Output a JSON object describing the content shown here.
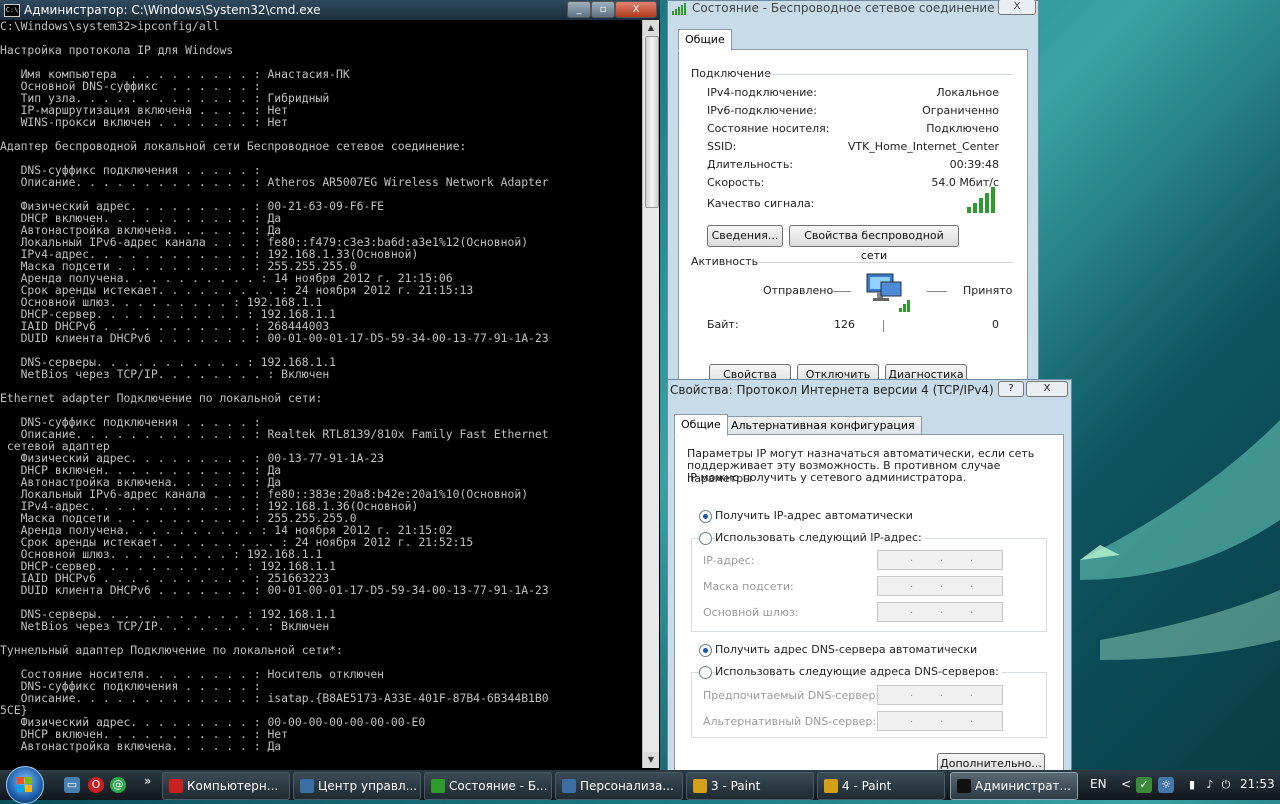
{
  "cmd": {
    "title": "Администратор: C:\\Windows\\System32\\cmd.exe",
    "minimize": "_",
    "maximize": "▫",
    "close": "X",
    "lines": [
      "C:\\Windows\\system32>ipconfig/all",
      "",
      "Настройка протокола IP для Windows",
      "",
      "   Имя компьютера  . . . . . . . . . : Анастасия-ПК",
      "   Основной DNS-суффикс  . . . . . . :",
      "   Тип узла. . . . . . . . . . . . . : Гибридный",
      "   IP-маршрутизация включена . . . . : Нет",
      "   WINS-прокси включен . . . . . . . : Нет",
      "",
      "Адаптер беспроводной локальной сети Беспроводное сетевое соединение:",
      "",
      "   DNS-суффикс подключения . . . . . :",
      "   Описание. . . . . . . . . . . . . : Atheros AR5007EG Wireless Network Adapter",
      "",
      "   Физический адрес. . . . . . . . . : 00-21-63-09-F6-FE",
      "   DHCP включен. . . . . . . . . . . : Да",
      "   Автонастройка включена. . . . . . : Да",
      "   Локальный IPv6-адрес канала . . . : fe80::f479:c3e3:ba6d:a3e1%12(Основной)",
      "   IPv4-адрес. . . . . . . . . . . . : 192.168.1.33(Основной)",
      "   Маска подсети . . . . . . . . . . : 255.255.255.0",
      "   Аренда получена. . . . . . . . . . : 14 ноября 2012 г. 21:15:06",
      "   Срок аренды истекает. . . . . . . . . : 24 ноября 2012 г. 21:15:13",
      "   Основной шлюз. . . . . . . . . : 192.168.1.1",
      "   DHCP-сервер. . . . . . . . . . . : 192.168.1.1",
      "   IAID DHCPv6 . . . . . . . . . . . : 268444003",
      "   DUID клиента DHCPv6 . . . . . . . : 00-01-00-01-17-D5-59-34-00-13-77-91-1A-23",
      "",
      "   DNS-серверы. . . . . . . . . . . : 192.168.1.1",
      "   NetBios через TCP/IP. . . . . . . . : Включен",
      "",
      "Ethernet adapter Подключение по локальной сети:",
      "",
      "   DNS-суффикс подключения . . . . . :",
      "   Описание. . . . . . . . . . . . . : Realtek RTL8139/810x Family Fast Ethernet",
      " сетевой адаптер",
      "   Физический адрес. . . . . . . . . : 00-13-77-91-1A-23",
      "   DHCP включен. . . . . . . . . . . : Да",
      "   Автонастройка включена. . . . . . : Да",
      "   Локальный IPv6-адрес канала . . . : fe80::383e:20a8:b42e:20a1%10(Основной)",
      "   IPv4-адрес. . . . . . . . . . . . : 192.168.1.36(Основной)",
      "   Маска подсети . . . . . . . . . . : 255.255.255.0",
      "   Аренда получена. . . . . . . . . . : 14 ноября 2012 г. 21:15:02",
      "   Срок аренды истекает. . . . . . . . . : 24 ноября 2012 г. 21:52:15",
      "   Основной шлюз. . . . . . . . . : 192.168.1.1",
      "   DHCP-сервер. . . . . . . . . . . : 192.168.1.1",
      "   IAID DHCPv6 . . . . . . . . . . . : 251663223",
      "   DUID клиента DHCPv6 . . . . . . . : 00-01-00-01-17-D5-59-34-00-13-77-91-1A-23",
      "",
      "   DNS-серверы. . . . . . . . . . . : 192.168.1.1",
      "   NetBios через TCP/IP. . . . . . . . : Включен",
      "",
      "Туннельный адаптер Подключение по локальной сети*:",
      "",
      "   Состояние носителя. . . . . . . . : Носитель отключен",
      "   DNS-суффикс подключения . . . . . :",
      "   Описание. . . . . . . . . . . . . : isatap.{B8AE5173-A33E-401F-87B4-6B344B1B0",
      "5CE}",
      "   Физический адрес. . . . . . . . . : 00-00-00-00-00-00-00-E0",
      "   DHCP включен. . . . . . . . . . . : Нет",
      "   Автонастройка включена. . . . . . : Да"
    ]
  },
  "status": {
    "title": "Состояние - Беспроводное сетевое соединение",
    "close": "X",
    "tab": "Общие",
    "connection_header": "Подключение",
    "rows": [
      {
        "k": "IPv4-подключение:",
        "v": "Локальное"
      },
      {
        "k": "IPv6-подключение:",
        "v": "Ограниченно"
      },
      {
        "k": "Состояние носителя:",
        "v": "Подключено"
      },
      {
        "k": "SSID:",
        "v": "VTK_Home_Internet_Center"
      },
      {
        "k": "Длительность:",
        "v": "00:39:48"
      },
      {
        "k": "Скорость:",
        "v": "54.0 Мбит/с"
      }
    ],
    "signal_label": "Качество сигнала:",
    "details_btn": "Сведения...",
    "wireless_props_btn": "Свойства беспроводной сети",
    "activity_header": "Активность",
    "sent_label": "Отправлено",
    "received_label": "Принято",
    "bytes_label": "Байт:",
    "bytes_sent": "126",
    "bytes_received": "0",
    "props_btn": "Свойства",
    "disconnect_btn": "Отключить",
    "diagnose_btn": "Диагностика"
  },
  "ipv4": {
    "title": "Свойства: Протокол Интернета версии 4 (TCP/IPv4)",
    "help": "?",
    "close": "X",
    "tab_general": "Общие",
    "tab_alternate": "Альтернативная конфигурация",
    "description": [
      "Параметры IP могут назначаться автоматически, если сеть",
      "поддерживает эту возможность. В противном случае параметры",
      "IP можно получить у сетевого администратора."
    ],
    "radio_auto_ip": "Получить IP-адрес автоматически",
    "radio_manual_ip": "Использовать следующий IP-адрес:",
    "ip_label": "IP-адрес:",
    "mask_label": "Маска подсети:",
    "gateway_label": "Основной шлюз:",
    "radio_auto_dns": "Получить адрес DNS-сервера автоматически",
    "radio_manual_dns": "Использовать следующие адреса DNS-серверов:",
    "pref_dns_label": "Предпочитаемый DNS-сервер:",
    "alt_dns_label": "Альтернативный DNS-сервер:",
    "advanced_btn": "Дополнительно...",
    "dot": "."
  },
  "taskbar": {
    "tasks": [
      {
        "label": "Компьютерн...",
        "icon": "opera-icon"
      },
      {
        "label": "Центр управл...",
        "icon": "network-center-icon"
      },
      {
        "label": "Состояние - Б...",
        "icon": "signal-icon"
      },
      {
        "label": "Персонализа...",
        "icon": "personalization-icon"
      },
      {
        "label": "3 - Paint",
        "icon": "paint-icon"
      },
      {
        "label": "4 - Paint",
        "icon": "paint-icon"
      },
      {
        "label": "Администрат...",
        "icon": "cmd-icon"
      }
    ],
    "overflow": "»",
    "lang": "EN",
    "tray_arrow": "<",
    "time": "21:53"
  },
  "colors": {
    "cmd_text": "#c0c0c0",
    "selected_radio": "#1e5aa8",
    "signal_green": "#2e9b2e"
  }
}
